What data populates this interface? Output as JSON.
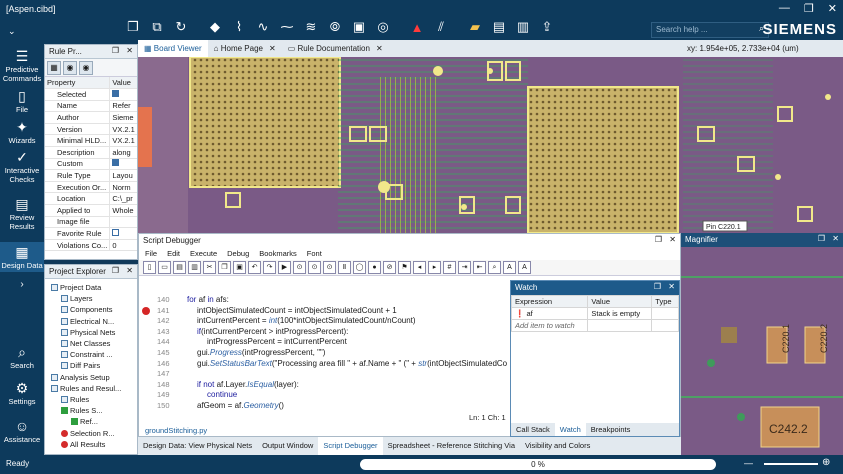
{
  "app": {
    "file_title": "[Aspen.cibd]",
    "brand": "SIEMENS",
    "search_placeholder": "Search help ...",
    "window_buttons": [
      "—",
      "❐",
      "✕"
    ]
  },
  "left_nav": [
    {
      "icon": "predictive-commands-icon",
      "label": "Predictive Commands"
    },
    {
      "icon": "file-icon",
      "label": "File"
    },
    {
      "icon": "wizards-icon",
      "label": "Wizards"
    },
    {
      "icon": "interactive-checks-icon",
      "label": "Interactive Checks"
    },
    {
      "icon": "review-results-icon",
      "label": "Review Results"
    },
    {
      "icon": "design-data-icon",
      "label": "Design Data"
    },
    {
      "icon": "search-icon",
      "label": "Search"
    },
    {
      "icon": "settings-icon",
      "label": "Settings"
    },
    {
      "icon": "assistance-icon",
      "label": "Assistance"
    }
  ],
  "rule_panel": {
    "title": "Rule Pr...",
    "headers": [
      "Property",
      "Value"
    ],
    "rows": [
      {
        "name": "Selected",
        "value": "checked"
      },
      {
        "name": "Name",
        "value": "Refer"
      },
      {
        "name": "Author",
        "value": "Sieme"
      },
      {
        "name": "Version",
        "value": "VX.2.1"
      },
      {
        "name": "Minimal HLD...",
        "value": "VX.2.1"
      },
      {
        "name": "Description",
        "value": "along"
      },
      {
        "name": "Custom",
        "value": "checked"
      },
      {
        "name": "Rule Type",
        "value": "Layou"
      },
      {
        "name": "Execution Or...",
        "value": "Norm"
      },
      {
        "name": "Location",
        "value": "C:\\_pr"
      },
      {
        "name": "Applied to",
        "value": "Whole"
      },
      {
        "name": "Image file",
        "value": ""
      },
      {
        "name": "Favorite Rule",
        "value": "unchecked"
      },
      {
        "name": "Violations Co...",
        "value": "0"
      }
    ]
  },
  "project_explorer": {
    "title": "Project Explorer",
    "items": [
      {
        "label": "Project Data",
        "indent": 0,
        "mark": "sq"
      },
      {
        "label": "Layers",
        "indent": 1,
        "mark": "sq"
      },
      {
        "label": "Components",
        "indent": 1,
        "mark": "sq"
      },
      {
        "label": "Electrical N...",
        "indent": 1,
        "mark": "sq"
      },
      {
        "label": "Physical Nets",
        "indent": 1,
        "mark": "sq"
      },
      {
        "label": "Net Classes",
        "indent": 1,
        "mark": "sq"
      },
      {
        "label": "Constraint ...",
        "indent": 1,
        "mark": "sq"
      },
      {
        "label": "Diff Pairs",
        "indent": 1,
        "mark": "sq"
      },
      {
        "label": "Analysis Setup",
        "indent": 0,
        "mark": "sq"
      },
      {
        "label": "Rules and Resul...",
        "indent": 0,
        "mark": "sq"
      },
      {
        "label": "Rules",
        "indent": 1,
        "mark": "sq"
      },
      {
        "label": "Rules S...",
        "indent": 1,
        "mark": "ck"
      },
      {
        "label": "Ref...",
        "indent": 2,
        "mark": "ck"
      },
      {
        "label": "Selection R...",
        "indent": 1,
        "mark": "rd"
      },
      {
        "label": "All Results",
        "indent": 1,
        "mark": "rd"
      }
    ]
  },
  "doc_tabs": [
    {
      "label": "Board Viewer",
      "active": true,
      "closable": false
    },
    {
      "label": "Home Page",
      "active": false,
      "closable": true
    },
    {
      "label": "Rule Documentation",
      "active": false,
      "closable": true
    }
  ],
  "coords": "xy: 1.954e+05, 2.733e+04  (um)",
  "board_labels": [
    "Pin C220.1"
  ],
  "debugger": {
    "title": "Script Debugger",
    "menu": [
      "File",
      "Edit",
      "Execute",
      "Debug",
      "Bookmarks",
      "Font"
    ],
    "lines": [
      {
        "n": "140",
        "text": "for af in afs:",
        "indent": 0,
        "bp": false
      },
      {
        "n": "141",
        "text": "intObjectSimulatedCount = intObjectSimulatedCount + 1",
        "indent": 1,
        "bp": true
      },
      {
        "n": "142",
        "text": "intCurrentPercent = int(100*intObjectSimulatedCount/nCount)",
        "indent": 1,
        "bp": false
      },
      {
        "n": "143",
        "text": "if(intCurrentPercent > intProgressPercent):",
        "indent": 1,
        "bp": false
      },
      {
        "n": "144",
        "text": "intProgressPercent = intCurrentPercent",
        "indent": 2,
        "bp": false
      },
      {
        "n": "145",
        "text": "gui.Progress(intProgressPercent, \"\")",
        "indent": 1,
        "bp": false
      },
      {
        "n": "146",
        "text": "gui.SetStatusBarText(\"Processing area fill \" + af.Name + \" (\" + str(intObjectSimulatedCo",
        "indent": 1,
        "bp": false
      },
      {
        "n": "147",
        "text": "",
        "indent": 0,
        "bp": false
      },
      {
        "n": "148",
        "text": "if not af.Layer.IsEqual(layer):",
        "indent": 1,
        "bp": false
      },
      {
        "n": "149",
        "text": "continue",
        "indent": 2,
        "bp": false
      },
      {
        "n": "150",
        "text": "afGeom = af.Geometry()",
        "indent": 1,
        "bp": false
      }
    ],
    "line_col": "Ln: 1   Ch: 1",
    "file": "groundStitching.py"
  },
  "watch": {
    "title": "Watch",
    "headers": [
      "Expression",
      "Value",
      "Type"
    ],
    "rows": [
      {
        "expr": "af",
        "value": "Stack is empty",
        "type": ""
      },
      {
        "expr": "Add item to watch",
        "value": "",
        "type": ""
      }
    ],
    "tabs": [
      {
        "label": "Call Stack",
        "on": false
      },
      {
        "label": "Watch",
        "on": true
      },
      {
        "label": "Breakpoints",
        "on": false
      }
    ]
  },
  "magnifier": {
    "title": "Magnifier",
    "labels": [
      "C220.1",
      "C220.2",
      "C242.2"
    ]
  },
  "bottom_tabs": [
    {
      "label": "Design Data: View Physical Nets",
      "on": false
    },
    {
      "label": "Output Window",
      "on": false
    },
    {
      "label": "Script Debugger",
      "on": true
    },
    {
      "label": "Spreadsheet - Reference Stitching Via",
      "on": false
    },
    {
      "label": "Visibility and Colors",
      "on": false
    }
  ],
  "status": {
    "text": "Ready",
    "progress_percent": 0,
    "progress_label": "0 %"
  },
  "colors": {
    "chrome": "#0d3a5c",
    "board": "#7a5a86",
    "accent": "#1b5e99",
    "breakpoint": "#d52626"
  }
}
